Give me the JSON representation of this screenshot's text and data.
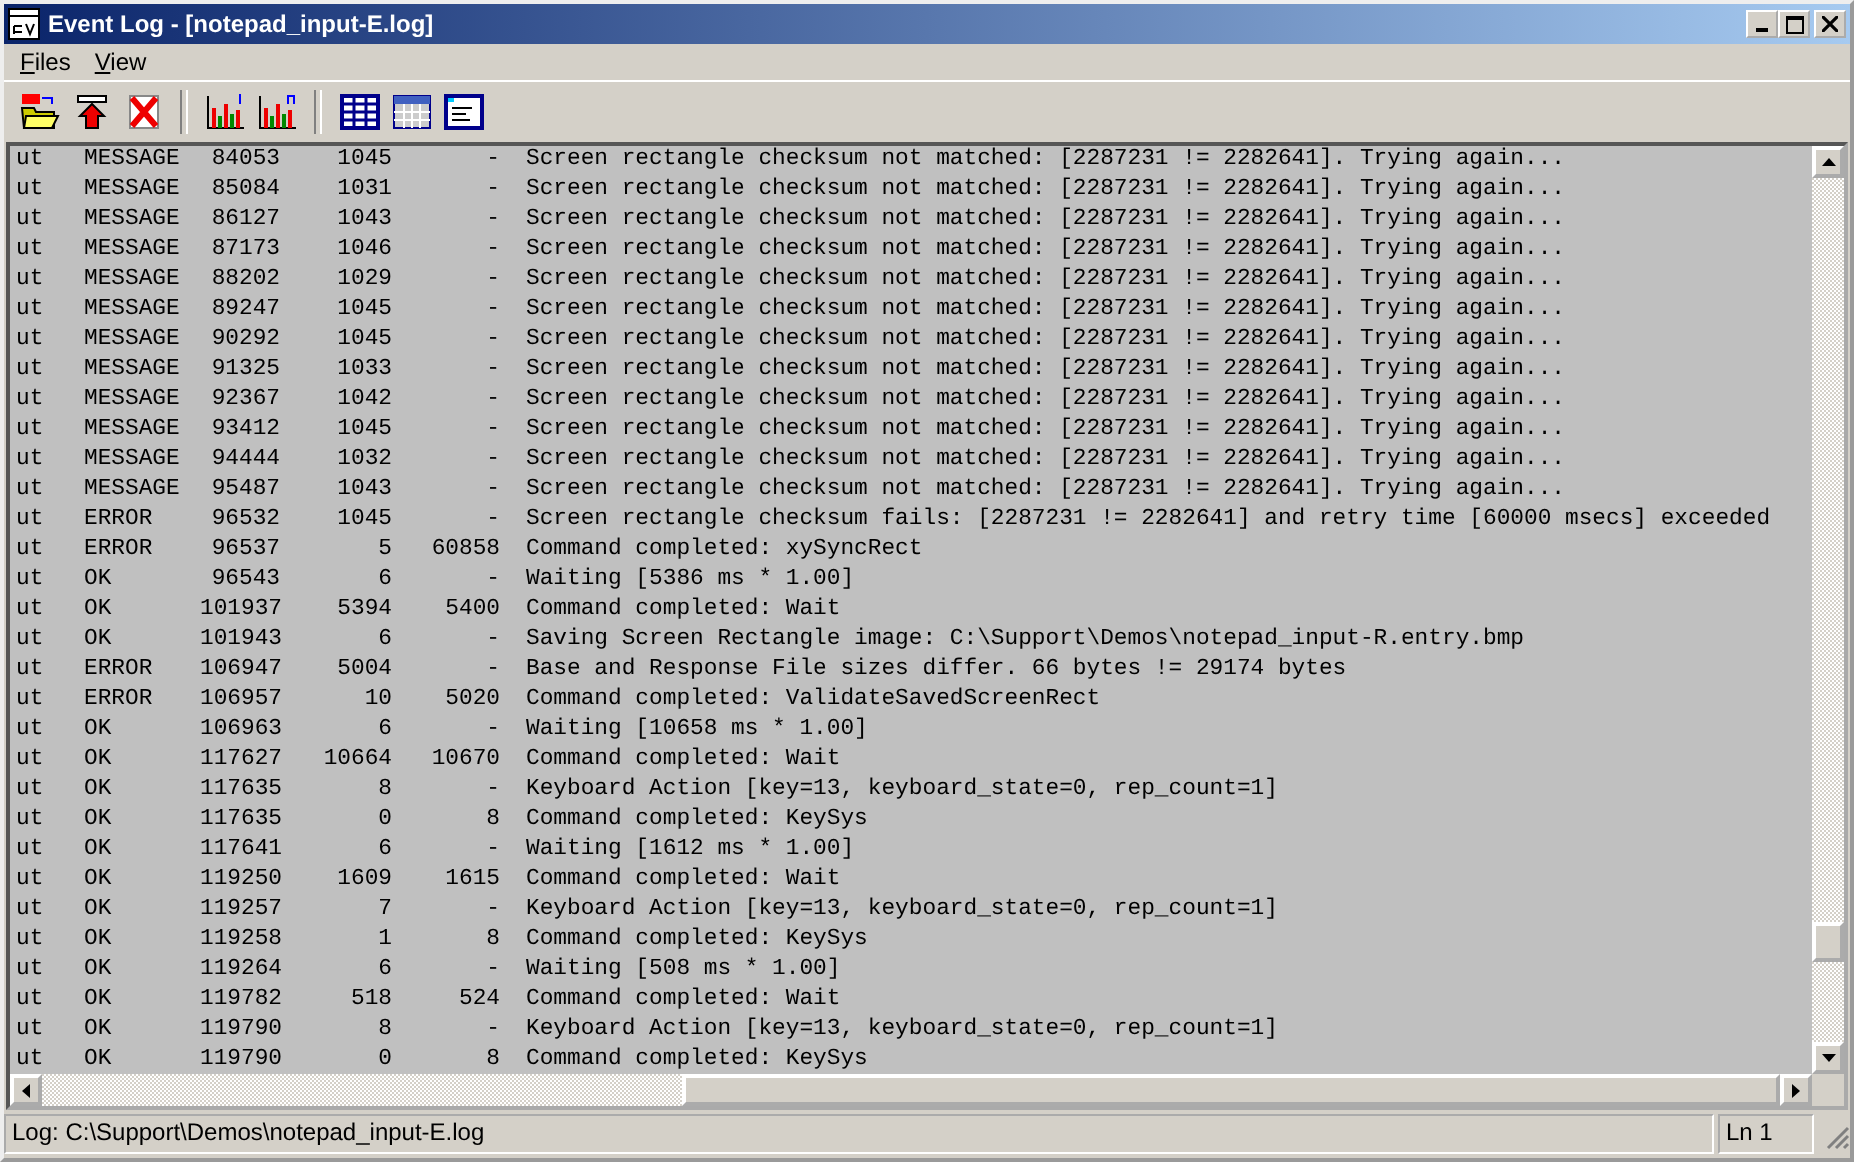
{
  "window": {
    "title": "Event Log - [notepad_input-E.log]"
  },
  "menu": [
    {
      "label": "Files"
    },
    {
      "label": "View"
    }
  ],
  "toolbar": [
    {
      "kind": "open-log"
    },
    {
      "kind": "upload"
    },
    {
      "kind": "delete"
    },
    {
      "kind": "separator"
    },
    {
      "kind": "chart-one"
    },
    {
      "kind": "chart-many"
    },
    {
      "kind": "separator"
    },
    {
      "kind": "grid"
    },
    {
      "kind": "table"
    },
    {
      "kind": "window"
    }
  ],
  "log": {
    "rows": [
      {
        "column_1": "ut",
        "column_2": "MESSAGE",
        "column_3": "84053",
        "column_4": "1045",
        "column_5": "-",
        "column_6": "Screen rectangle checksum not matched: [2287231 != 2282641]. Trying again..."
      },
      {
        "column_1": "ut",
        "column_2": "MESSAGE",
        "column_3": "85084",
        "column_4": "1031",
        "column_5": "-",
        "column_6": "Screen rectangle checksum not matched: [2287231 != 2282641]. Trying again..."
      },
      {
        "column_1": "ut",
        "column_2": "MESSAGE",
        "column_3": "86127",
        "column_4": "1043",
        "column_5": "-",
        "column_6": "Screen rectangle checksum not matched: [2287231 != 2282641]. Trying again..."
      },
      {
        "column_1": "ut",
        "column_2": "MESSAGE",
        "column_3": "87173",
        "column_4": "1046",
        "column_5": "-",
        "column_6": "Screen rectangle checksum not matched: [2287231 != 2282641]. Trying again..."
      },
      {
        "column_1": "ut",
        "column_2": "MESSAGE",
        "column_3": "88202",
        "column_4": "1029",
        "column_5": "-",
        "column_6": "Screen rectangle checksum not matched: [2287231 != 2282641]. Trying again..."
      },
      {
        "column_1": "ut",
        "column_2": "MESSAGE",
        "column_3": "89247",
        "column_4": "1045",
        "column_5": "-",
        "column_6": "Screen rectangle checksum not matched: [2287231 != 2282641]. Trying again..."
      },
      {
        "column_1": "ut",
        "column_2": "MESSAGE",
        "column_3": "90292",
        "column_4": "1045",
        "column_5": "-",
        "column_6": "Screen rectangle checksum not matched: [2287231 != 2282641]. Trying again..."
      },
      {
        "column_1": "ut",
        "column_2": "MESSAGE",
        "column_3": "91325",
        "column_4": "1033",
        "column_5": "-",
        "column_6": "Screen rectangle checksum not matched: [2287231 != 2282641]. Trying again..."
      },
      {
        "column_1": "ut",
        "column_2": "MESSAGE",
        "column_3": "92367",
        "column_4": "1042",
        "column_5": "-",
        "column_6": "Screen rectangle checksum not matched: [2287231 != 2282641]. Trying again..."
      },
      {
        "column_1": "ut",
        "column_2": "MESSAGE",
        "column_3": "93412",
        "column_4": "1045",
        "column_5": "-",
        "column_6": "Screen rectangle checksum not matched: [2287231 != 2282641]. Trying again..."
      },
      {
        "column_1": "ut",
        "column_2": "MESSAGE",
        "column_3": "94444",
        "column_4": "1032",
        "column_5": "-",
        "column_6": "Screen rectangle checksum not matched: [2287231 != 2282641]. Trying again..."
      },
      {
        "column_1": "ut",
        "column_2": "MESSAGE",
        "column_3": "95487",
        "column_4": "1043",
        "column_5": "-",
        "column_6": "Screen rectangle checksum not matched: [2287231 != 2282641]. Trying again..."
      },
      {
        "column_1": "ut",
        "column_2": "ERROR",
        "column_3": "96532",
        "column_4": "1045",
        "column_5": "-",
        "column_6": "Screen rectangle checksum fails: [2287231 != 2282641] and retry time [60000 msecs] exceeded"
      },
      {
        "column_1": "ut",
        "column_2": "ERROR",
        "column_3": "96537",
        "column_4": "5",
        "column_5": "60858",
        "column_6": "Command completed: xySyncRect"
      },
      {
        "column_1": "ut",
        "column_2": "OK",
        "column_3": "96543",
        "column_4": "6",
        "column_5": "-",
        "column_6": "Waiting [5386 ms * 1.00]"
      },
      {
        "column_1": "ut",
        "column_2": "OK",
        "column_3": "101937",
        "column_4": "5394",
        "column_5": "5400",
        "column_6": "Command completed: Wait"
      },
      {
        "column_1": "ut",
        "column_2": "OK",
        "column_3": "101943",
        "column_4": "6",
        "column_5": "-",
        "column_6": "Saving Screen Rectangle image: C:\\Support\\Demos\\notepad_input-R.entry.bmp"
      },
      {
        "column_1": "ut",
        "column_2": "ERROR",
        "column_3": "106947",
        "column_4": "5004",
        "column_5": "-",
        "column_6": "Base and Response File sizes differ. 66 bytes != 29174 bytes"
      },
      {
        "column_1": "ut",
        "column_2": "ERROR",
        "column_3": "106957",
        "column_4": "10",
        "column_5": "5020",
        "column_6": "Command completed: ValidateSavedScreenRect"
      },
      {
        "column_1": "ut",
        "column_2": "OK",
        "column_3": "106963",
        "column_4": "6",
        "column_5": "-",
        "column_6": "Waiting [10658 ms * 1.00]"
      },
      {
        "column_1": "ut",
        "column_2": "OK",
        "column_3": "117627",
        "column_4": "10664",
        "column_5": "10670",
        "column_6": "Command completed: Wait"
      },
      {
        "column_1": "ut",
        "column_2": "OK",
        "column_3": "117635",
        "column_4": "8",
        "column_5": "-",
        "column_6": "Keyboard Action [key=13, keyboard_state=0, rep_count=1]"
      },
      {
        "column_1": "ut",
        "column_2": "OK",
        "column_3": "117635",
        "column_4": "0",
        "column_5": "8",
        "column_6": "Command completed: KeySys"
      },
      {
        "column_1": "ut",
        "column_2": "OK",
        "column_3": "117641",
        "column_4": "6",
        "column_5": "-",
        "column_6": "Waiting [1612 ms * 1.00]"
      },
      {
        "column_1": "ut",
        "column_2": "OK",
        "column_3": "119250",
        "column_4": "1609",
        "column_5": "1615",
        "column_6": "Command completed: Wait"
      },
      {
        "column_1": "ut",
        "column_2": "OK",
        "column_3": "119257",
        "column_4": "7",
        "column_5": "-",
        "column_6": "Keyboard Action [key=13, keyboard_state=0, rep_count=1]"
      },
      {
        "column_1": "ut",
        "column_2": "OK",
        "column_3": "119258",
        "column_4": "1",
        "column_5": "8",
        "column_6": "Command completed: KeySys"
      },
      {
        "column_1": "ut",
        "column_2": "OK",
        "column_3": "119264",
        "column_4": "6",
        "column_5": "-",
        "column_6": "Waiting [508 ms * 1.00]"
      },
      {
        "column_1": "ut",
        "column_2": "OK",
        "column_3": "119782",
        "column_4": "518",
        "column_5": "524",
        "column_6": "Command completed: Wait"
      },
      {
        "column_1": "ut",
        "column_2": "OK",
        "column_3": "119790",
        "column_4": "8",
        "column_5": "-",
        "column_6": "Keyboard Action [key=13, keyboard_state=0, rep_count=1]"
      },
      {
        "column_1": "ut",
        "column_2": "OK",
        "column_3": "119790",
        "column_4": "0",
        "column_5": "8",
        "column_6": "Command completed: KeySys"
      }
    ]
  },
  "status_bar": {
    "path": "Log: C:\\Support\\Demos\\notepad_input-E.log",
    "line": "Ln 1"
  }
}
